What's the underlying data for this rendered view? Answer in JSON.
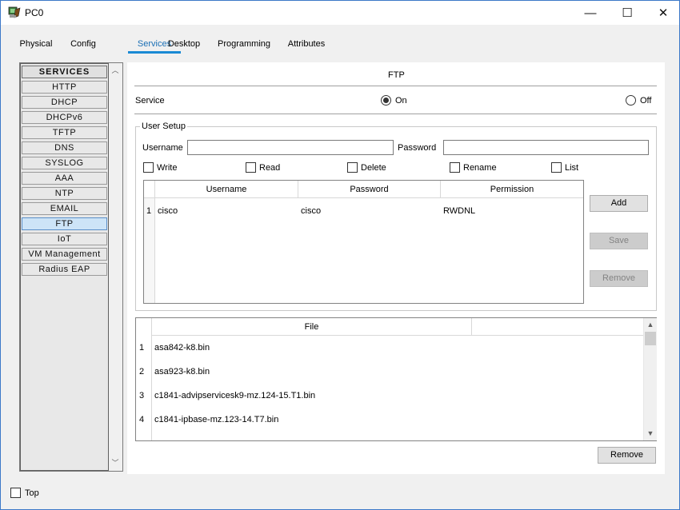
{
  "window": {
    "title": "PC0",
    "minimize": "—",
    "maximize": "☐",
    "close": "✕"
  },
  "tabs": [
    {
      "label": "Physical"
    },
    {
      "label": "Config"
    },
    {
      "label": "Services"
    },
    {
      "label": "Desktop"
    },
    {
      "label": "Programming"
    },
    {
      "label": "Attributes"
    }
  ],
  "services": {
    "header": "SERVICES",
    "items": [
      "HTTP",
      "DHCP",
      "DHCPv6",
      "TFTP",
      "DNS",
      "SYSLOG",
      "AAA",
      "NTP",
      "EMAIL",
      "FTP",
      "IoT",
      "VM Management",
      "Radius EAP"
    ],
    "active": "FTP"
  },
  "ftp": {
    "title": "FTP",
    "service_label": "Service",
    "on_label": "On",
    "off_label": "Off",
    "service_state": "On",
    "user_setup": {
      "legend": "User Setup",
      "username_label": "Username",
      "username_value": "",
      "password_label": "Password",
      "password_value": "",
      "permissions": [
        {
          "label": "Write",
          "checked": false
        },
        {
          "label": "Read",
          "checked": false
        },
        {
          "label": "Delete",
          "checked": false
        },
        {
          "label": "Rename",
          "checked": false
        },
        {
          "label": "List",
          "checked": false
        }
      ],
      "columns": [
        "Username",
        "Password",
        "Permission"
      ],
      "rows": [
        {
          "num": "1",
          "username": "cisco",
          "password": "cisco",
          "permission": "RWDNL"
        }
      ],
      "buttons": {
        "add": "Add",
        "save": "Save",
        "remove": "Remove"
      }
    },
    "files": {
      "column": "File",
      "rows": [
        {
          "num": "1",
          "name": "asa842-k8.bin"
        },
        {
          "num": "2",
          "name": "asa923-k8.bin"
        },
        {
          "num": "3",
          "name": "c1841-advipservicesk9-mz.124-15.T1.bin"
        },
        {
          "num": "4",
          "name": "c1841-ipbase-mz.123-14.T7.bin"
        }
      ],
      "remove_button": "Remove"
    }
  },
  "footer": {
    "top_label": "Top",
    "top_checked": false
  }
}
